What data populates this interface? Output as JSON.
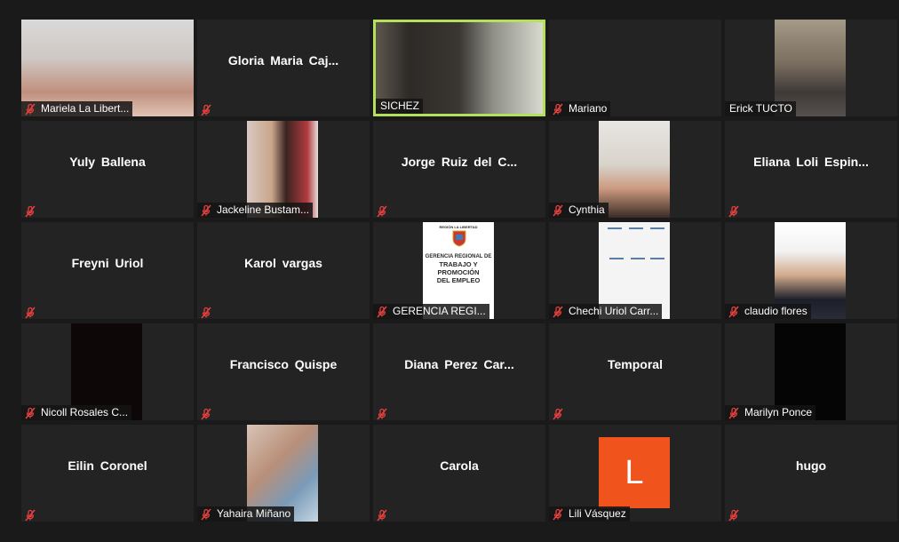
{
  "participants": [
    {
      "name": "Mariela La Libert...",
      "video": "mariela"
    },
    {
      "name": "Gloria  Maria  Caj...",
      "video": null
    },
    {
      "name": "SICHEZ",
      "video": "sichez",
      "active": true,
      "muted": false
    },
    {
      "name": "Mariano",
      "video": null,
      "blank": true
    },
    {
      "name": "Erick TUCTO",
      "video": "erick",
      "muted": false
    },
    {
      "name": "Yuly Ballena",
      "video": null
    },
    {
      "name": "Jackeline Bustam...",
      "video": "jackeline"
    },
    {
      "name": "Jorge  Ruiz  del  C...",
      "video": null
    },
    {
      "name": "Cynthia",
      "video": "cynthia"
    },
    {
      "name": "Eliana  Loli  Espin...",
      "video": null
    },
    {
      "name": "Freyni Uriol",
      "video": null
    },
    {
      "name": "Karol vargas",
      "video": null
    },
    {
      "name": "GERENCIA REGI...",
      "video": "gerencia"
    },
    {
      "name": "Chechi Uriol Carr...",
      "video": "chechi"
    },
    {
      "name": "claudio flores",
      "video": "claudio"
    },
    {
      "name": "Nicoll Rosales C...",
      "video": "black"
    },
    {
      "name": "Francisco Quispe",
      "video": null
    },
    {
      "name": "Diana  Perez  Car...",
      "video": null
    },
    {
      "name": "Temporal",
      "video": null
    },
    {
      "name": "Marilyn Ponce",
      "video": "black2"
    },
    {
      "name": "Eilin Coronel",
      "video": null
    },
    {
      "name": "Yahaira Miñano",
      "video": "yahaira"
    },
    {
      "name": "Carola",
      "video": null
    },
    {
      "name": "Lili Vásquez",
      "video": "letter",
      "letter": "L"
    },
    {
      "name": "hugo",
      "video": null
    }
  ],
  "gerencia_logo": {
    "top": "REGIÓN LA LIBERTAD",
    "line1": "GERENCIA REGIONAL DE",
    "line2": "TRABAJO Y PROMOCIÓN",
    "line3": "DEL EMPLEO"
  },
  "colors": {
    "background": "#1a1a1a",
    "tile": "#232323",
    "active_border": "#b4e05b",
    "muted_icon": "#e8413e",
    "avatar_letter_bg": "#f0531c"
  },
  "icons": {
    "muted": "microphone-muted-icon"
  }
}
